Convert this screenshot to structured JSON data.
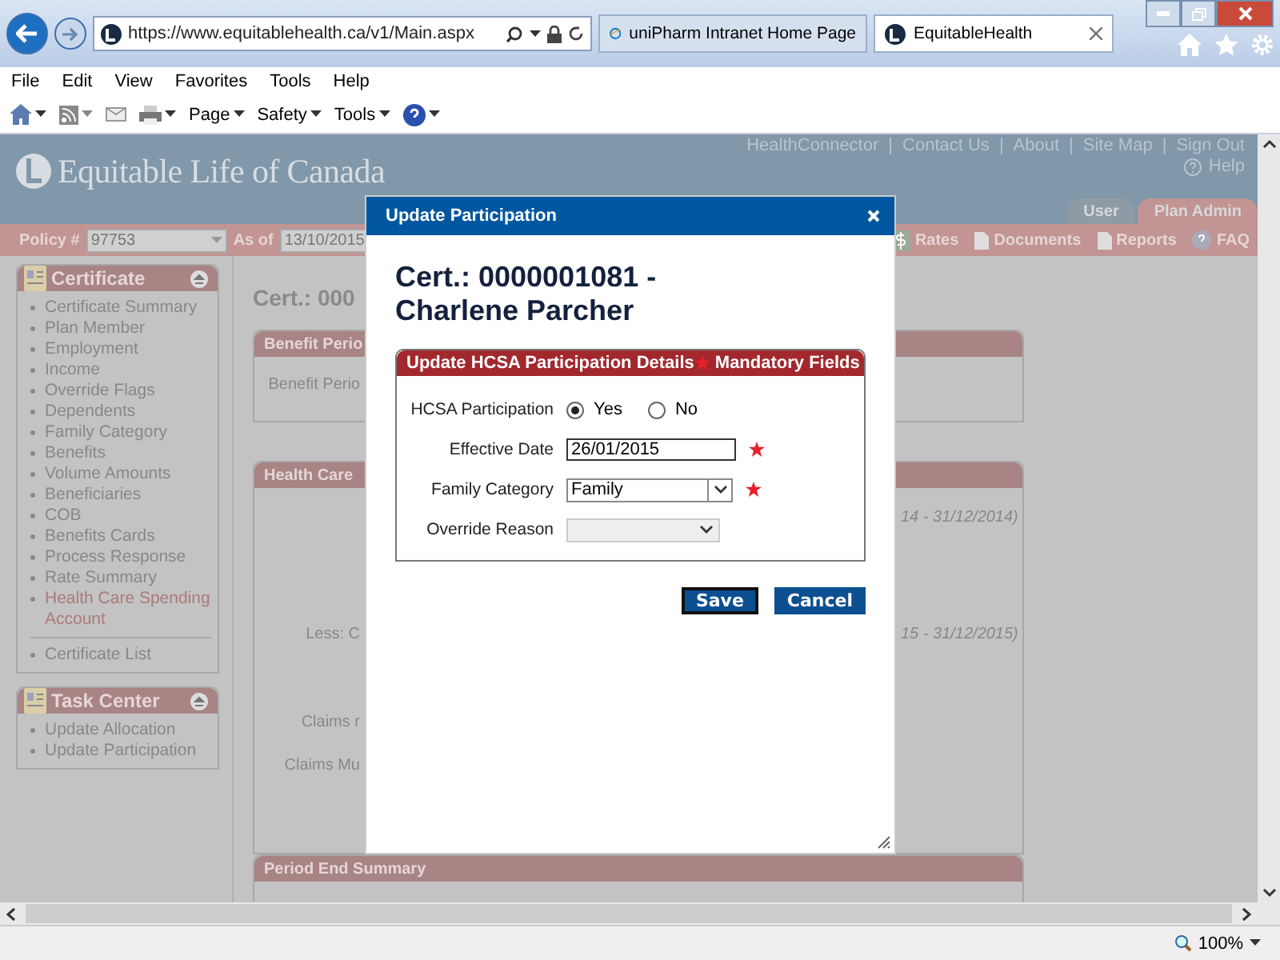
{
  "browser": {
    "address": "https://www.equitablehealth.ca/v1/Main.aspx",
    "tabs": [
      {
        "title": "uniPharm Intranet Home Page",
        "selected": false
      },
      {
        "title": "EquitableHealth",
        "selected": true
      }
    ],
    "menu": [
      "File",
      "Edit",
      "View",
      "Favorites",
      "Tools",
      "Help"
    ],
    "command_bar": [
      "Page",
      "Safety",
      "Tools"
    ],
    "zoom": "100%"
  },
  "header": {
    "logo": "Equitable Life of Canada",
    "top_links": [
      "HealthConnector",
      "Contact Us",
      "About",
      "Site Map",
      "Sign Out"
    ],
    "link_separator": "|",
    "help": "Help",
    "tabs": [
      {
        "label": "User",
        "selected": false
      },
      {
        "label": "Plan Admin",
        "selected": true
      }
    ]
  },
  "toolbar": {
    "policy_label": "Policy #",
    "policy": "97753",
    "as_of_label": "As of",
    "as_of": "13/10/2015",
    "links": [
      "Rates",
      "Documents",
      "Reports",
      "FAQ"
    ]
  },
  "sidebar": {
    "panels": [
      {
        "title": "Certificate",
        "items": [
          {
            "label": "Certificate Summary",
            "selected": false
          },
          {
            "label": "Plan Member",
            "selected": false
          },
          {
            "label": "Employment",
            "selected": false
          },
          {
            "label": "Income",
            "selected": false
          },
          {
            "label": "Override Flags",
            "selected": false
          },
          {
            "label": "Dependents",
            "selected": false
          },
          {
            "label": "Family Category",
            "selected": false
          },
          {
            "label": "Benefits",
            "selected": false
          },
          {
            "label": "Volume Amounts",
            "selected": false
          },
          {
            "label": "Beneficiaries",
            "selected": false
          },
          {
            "label": "COB",
            "selected": false
          },
          {
            "label": "Benefits Cards",
            "selected": false
          },
          {
            "label": "Process Response",
            "selected": false
          },
          {
            "label": "Rate Summary",
            "selected": false
          },
          {
            "label": "Health Care Spending Account",
            "selected": true
          }
        ],
        "footer_items": [
          {
            "label": "Certificate List",
            "selected": false
          }
        ]
      },
      {
        "title": "Task Center",
        "items": [
          {
            "label": "Update Allocation",
            "selected": false
          },
          {
            "label": "Update Participation",
            "selected": false
          }
        ]
      }
    ]
  },
  "main": {
    "heading": "Cert.: 000",
    "benefit_panel": {
      "title": "Benefit Perio",
      "label": "Benefit Perio"
    },
    "health_panel": {
      "title": "Health Care",
      "period_1": "14 - 31/12/2014)",
      "label_1": "Less: C",
      "period_2": "15 - 31/12/2015)",
      "label_2": "Claims r",
      "label_3": "Claims Mu"
    },
    "summary_panel": {
      "title": "Period End Summary"
    }
  },
  "dialog": {
    "title": "Update Participation",
    "heading_line_1": "Cert.: 0000001081 -",
    "heading_line_2": "Charlene Parcher",
    "section_title": "Update HCSA Participation Details",
    "mandatory_note": "Mandatory Fields",
    "participation_label": "HCSA Participation",
    "participation_options": [
      {
        "label": "Yes",
        "selected": true
      },
      {
        "label": "No",
        "selected": false
      }
    ],
    "effective_date_label": "Effective Date",
    "effective_date": "26/01/2015",
    "family_category_label": "Family Category",
    "family_category": "Family",
    "override_reason_label": "Override Reason",
    "buttons": [
      "Save",
      "Cancel"
    ]
  }
}
